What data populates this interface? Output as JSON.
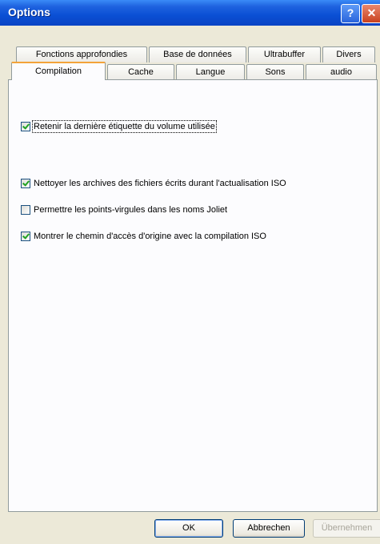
{
  "window": {
    "title": "Options"
  },
  "titlebar": {
    "help_glyph": "?",
    "close_glyph": "✕"
  },
  "tabs_row1": [
    {
      "label": "Fonctions approfondies"
    },
    {
      "label": "Base de données"
    },
    {
      "label": "Ultrabuffer"
    },
    {
      "label": "Divers"
    }
  ],
  "tabs_row2": [
    {
      "label": "Compilation",
      "active": true
    },
    {
      "label": "Cache"
    },
    {
      "label": "Langue"
    },
    {
      "label": "Sons"
    },
    {
      "label": "audio"
    }
  ],
  "options": [
    {
      "label": "Retenir la dernière étiquette du volume utilisée",
      "checked": true
    },
    {
      "label": "Nettoyer les archives des fichiers écrits durant l'actualisation ISO",
      "checked": true
    },
    {
      "label": "Permettre les points-virgules dans les noms Joliet",
      "checked": false
    },
    {
      "label": "Montrer le chemin d'accès d'origine avec la compilation ISO",
      "checked": true
    }
  ],
  "buttons": {
    "ok": "OK",
    "cancel": "Abbrechen",
    "apply": "Übernehmen",
    "apply_enabled": false
  },
  "colors": {
    "titlebar": "#0a4fd4",
    "dialog_bg": "#ece9d8",
    "active_tab_accent": "#f3a33a",
    "check_mark": "#21a121"
  }
}
